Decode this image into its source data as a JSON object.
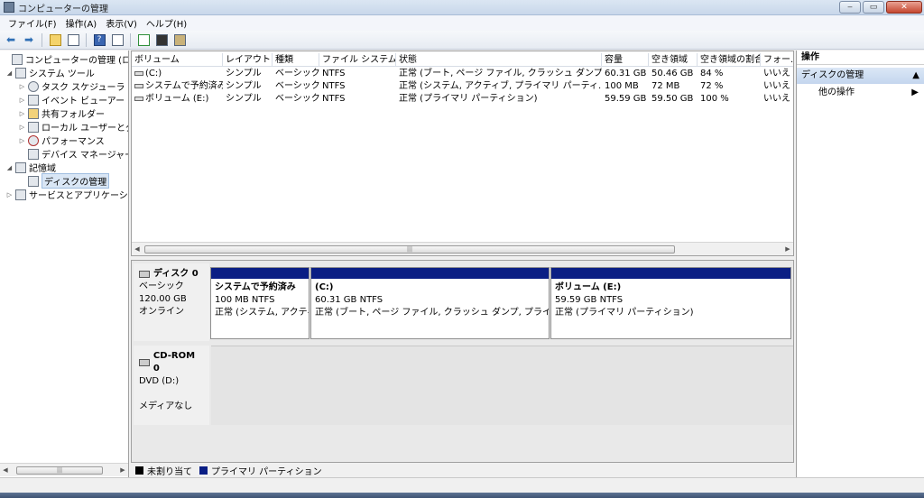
{
  "window": {
    "title": "コンピューターの管理"
  },
  "window_buttons": {
    "minimize": "‒",
    "maximize": "▭",
    "close": "✕"
  },
  "menu": [
    "ファイル(F)",
    "操作(A)",
    "表示(V)",
    "ヘルプ(H)"
  ],
  "tree": {
    "items": [
      {
        "label": "コンピューターの管理 (ローカ",
        "toggle": "",
        "icon": "computer-mgmt-icon"
      },
      {
        "label": "システム ツール",
        "toggle": "◢",
        "icon": "tools-icon"
      },
      {
        "label": "タスク スケジューラ",
        "toggle": "▷",
        "icon": "clock-icon"
      },
      {
        "label": "イベント ビューアー",
        "toggle": "▷",
        "icon": "event-viewer-icon"
      },
      {
        "label": "共有フォルダー",
        "toggle": "▷",
        "icon": "shared-folder-icon"
      },
      {
        "label": "ローカル ユーザーとグ",
        "toggle": "▷",
        "icon": "users-icon"
      },
      {
        "label": "パフォーマンス",
        "toggle": "▷",
        "icon": "performance-icon"
      },
      {
        "label": "デバイス マネージャー",
        "toggle": "",
        "icon": "device-manager-icon"
      },
      {
        "label": "記憶域",
        "toggle": "◢",
        "icon": "storage-icon"
      },
      {
        "label": "ディスクの管理",
        "toggle": "",
        "icon": "disk-management-icon"
      },
      {
        "label": "サービスとアプリケーショ",
        "toggle": "▷",
        "icon": "services-icon"
      }
    ]
  },
  "volumes": {
    "columns": [
      "ボリューム",
      "レイアウト",
      "種類",
      "ファイル システム",
      "状態",
      "容量",
      "空き領域",
      "空き領域の割合",
      "フォー..."
    ],
    "rows": [
      [
        "(C:)",
        "シンプル",
        "ベーシック",
        "NTFS",
        "正常 (ブート, ページ ファイル, クラッシュ ダンプ,...",
        "60.31 GB",
        "50.46 GB",
        "84 %",
        "いいえ"
      ],
      [
        "システムで予約済み",
        "シンプル",
        "ベーシック",
        "NTFS",
        "正常 (システム, アクティブ, プライマリ パーティ...",
        "100 MB",
        "72 MB",
        "72 %",
        "いいえ"
      ],
      [
        "ボリューム (E:)",
        "シンプル",
        "ベーシック",
        "NTFS",
        "正常 (プライマリ パーティション)",
        "59.59 GB",
        "59.50 GB",
        "100 %",
        "いいえ"
      ]
    ]
  },
  "disks": [
    {
      "title": "ディスク 0",
      "type": "ベーシック",
      "size": "120.00 GB",
      "state": "オンライン",
      "partitions": [
        {
          "name": "システムで予約済み",
          "size": "100 MB NTFS",
          "status": "正常 (システム, アクティ"
        },
        {
          "name": "(C:)",
          "size": "60.31 GB NTFS",
          "status": "正常 (ブート, ページ ファイル, クラッシュ ダンプ, プライマリ"
        },
        {
          "name": "ボリューム (E:)",
          "size": "59.59 GB NTFS",
          "status": "正常 (プライマリ パーティション)"
        }
      ]
    },
    {
      "title": "CD-ROM 0",
      "type": "DVD (D:)",
      "state": "メディアなし"
    }
  ],
  "legend": {
    "unallocated": {
      "label": "未割り当て",
      "color": "#000000"
    },
    "primary": {
      "label": "プライマリ パーティション",
      "color": "#0a1e84"
    }
  },
  "actions": {
    "header": "操作",
    "section": "ディスクの管理",
    "item": "他の操作"
  }
}
